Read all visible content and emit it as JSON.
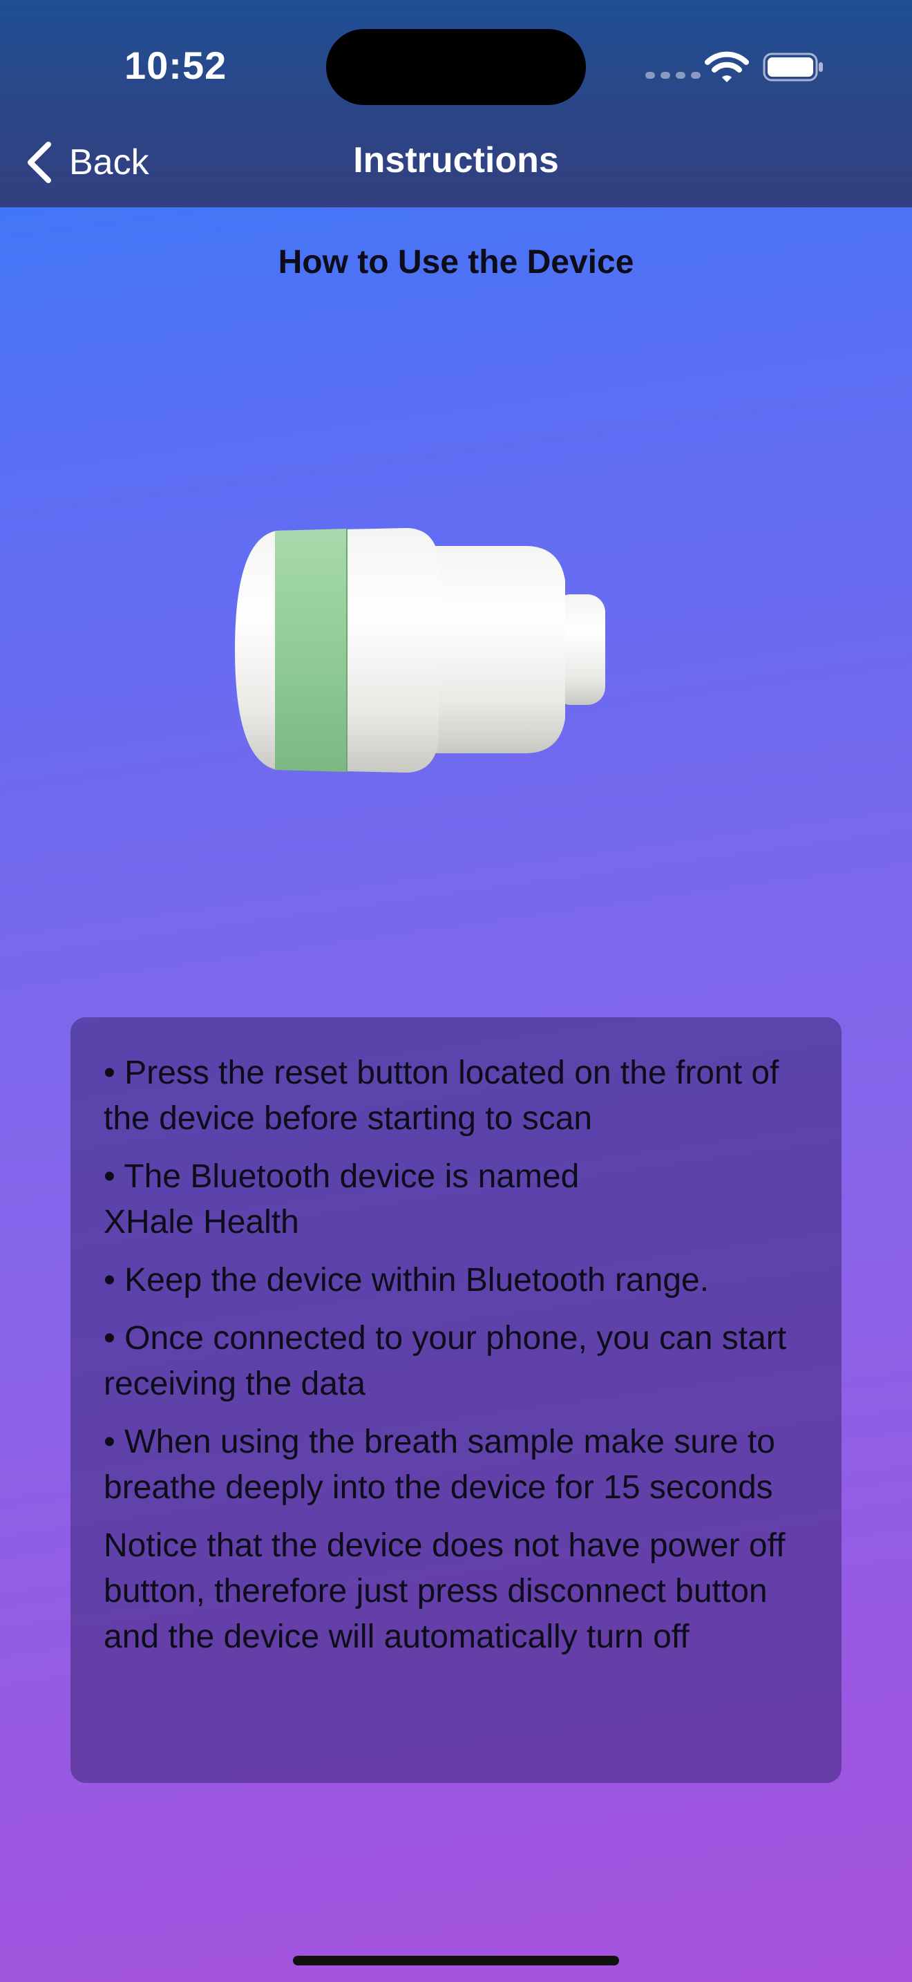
{
  "status_bar": {
    "time": "10:52"
  },
  "nav": {
    "back_label": "Back",
    "title": "Instructions"
  },
  "page": {
    "title": "How to Use the Device"
  },
  "instructions": [
    "• Press the reset button located on the front of the device before starting to scan",
    "• The Bluetooth device is named XHale Health",
    "• Keep the device within Bluetooth range.",
    "• Once connected to your phone, you can start receiving the data",
    "• When using the breath sample make sure to breathe deeply into the device for 15 seconds",
    "Notice that the device does not have power off button, therefore just press disconnect button and the device will automatically turn off"
  ],
  "colors": {
    "accent_green": "#8ccb94",
    "header_bg": "#2a4788",
    "card_bg": "#3c2878"
  },
  "icons": {
    "back": "chevron-left-icon",
    "wifi": "wifi-icon",
    "battery": "battery-icon"
  }
}
